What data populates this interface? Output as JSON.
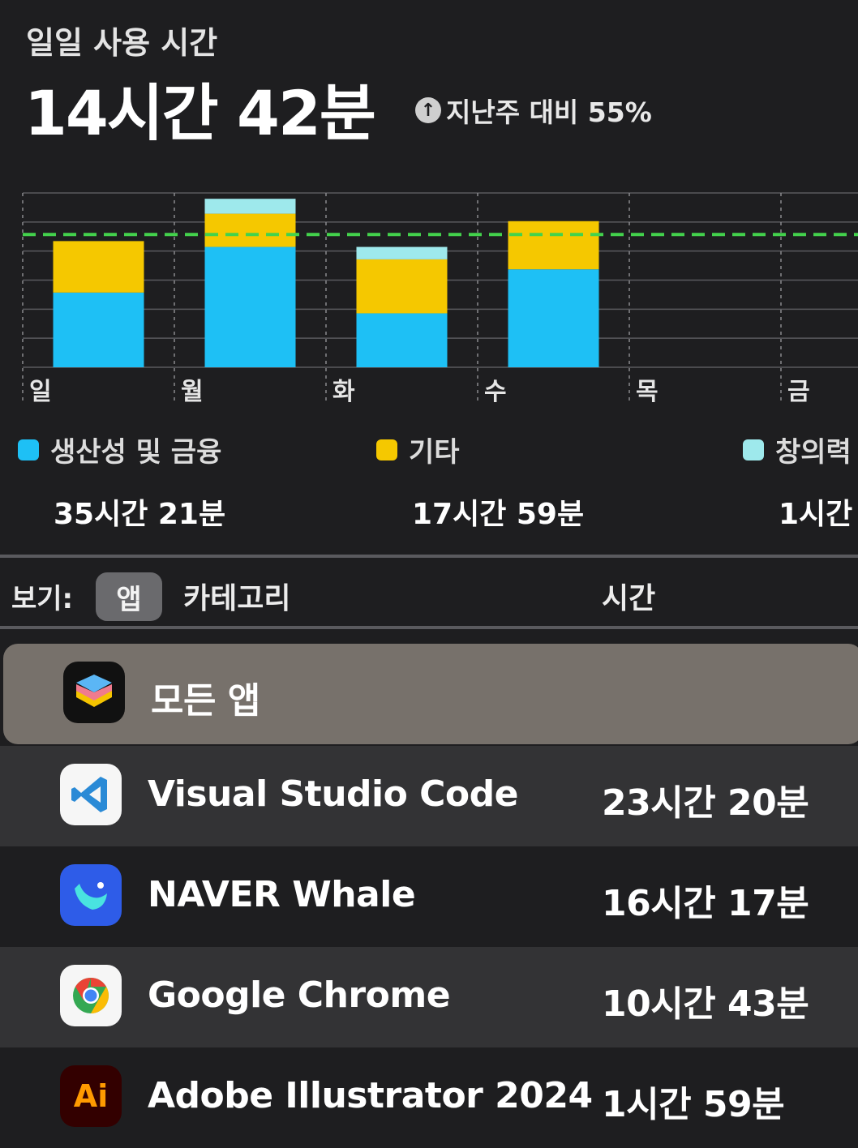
{
  "header": {
    "label": "일일 사용 시간",
    "total": "14시간 42분",
    "compare_arrow": "↑",
    "compare_text": "지난주 대비 55%"
  },
  "colors": {
    "productivity": "#1ec0f5",
    "other": "#f5c800",
    "creativity": "#9ee9ec",
    "average_line": "#43d24c",
    "background": "#1e1e20"
  },
  "chart_data": {
    "type": "bar",
    "stacked": true,
    "categories": [
      "일",
      "월",
      "화",
      "수",
      "목",
      "금"
    ],
    "series": [
      {
        "name": "생산성 및 금융",
        "color": "#1ec0f5",
        "values": [
          90,
          145,
          65,
          118,
          0,
          0
        ]
      },
      {
        "name": "기타",
        "color": "#f5c800",
        "values": [
          62,
          40,
          65,
          58,
          0,
          0
        ]
      },
      {
        "name": "창의력",
        "color": "#9ee9ec",
        "values": [
          0,
          18,
          15,
          0,
          0,
          0
        ]
      }
    ],
    "average_line": 160,
    "ylim": [
      0,
      210
    ],
    "grid": true,
    "xlabel": "",
    "ylabel": "",
    "title": ""
  },
  "legend": [
    {
      "name": "생산성 및 금융",
      "value": "35시간 21분",
      "color": "#1ec0f5"
    },
    {
      "name": "기타",
      "value": "17시간 59분",
      "color": "#f5c800"
    },
    {
      "name": "창의력",
      "value": "1시간",
      "color": "#9ee9ec"
    }
  ],
  "view": {
    "label": "보기:",
    "app": "앱",
    "category": "카테고리",
    "time_header": "시간"
  },
  "apps": [
    {
      "name": "모든 앱",
      "time": "",
      "icon": "stack-icon",
      "style": "selected"
    },
    {
      "name": "Visual Studio Code",
      "time": "23시간 20분",
      "icon": "vscode-icon",
      "style": "alt"
    },
    {
      "name": "NAVER Whale",
      "time": "16시간 17분",
      "icon": "whale-icon",
      "style": "plain"
    },
    {
      "name": "Google Chrome",
      "time": "10시간 43분",
      "icon": "chrome-icon",
      "style": "alt"
    },
    {
      "name": "Adobe Illustrator 2024",
      "time": "1시간 59분",
      "icon": "illustrator-icon",
      "style": "plain",
      "icon_text": "Ai"
    }
  ]
}
